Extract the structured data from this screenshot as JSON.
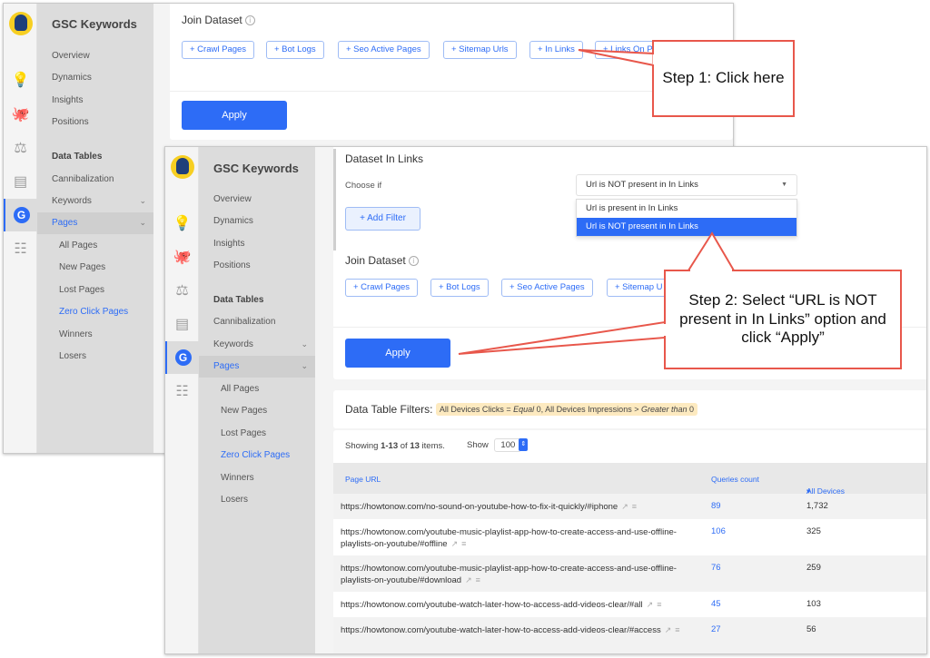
{
  "app": {
    "title": "GSC Keywords"
  },
  "sidebar": {
    "icons": [
      "app-logo-icon",
      "seo-bulb-gear-icon",
      "octopus-icon",
      "scales-icon",
      "log-files-icon",
      "google-g-icon",
      "data-table-icon"
    ],
    "items": [
      {
        "label": "Overview"
      },
      {
        "label": "Dynamics"
      },
      {
        "label": "Insights"
      },
      {
        "label": "Positions"
      }
    ],
    "data_tables_heading": "Data Tables",
    "data_table_items": [
      {
        "label": "Cannibalization"
      },
      {
        "label": "Keywords"
      },
      {
        "label": "Pages"
      }
    ],
    "page_subitems": [
      {
        "label": "All Pages"
      },
      {
        "label": "New Pages"
      },
      {
        "label": "Lost Pages"
      },
      {
        "label": "Zero Click Pages"
      },
      {
        "label": "Winners"
      },
      {
        "label": "Losers"
      }
    ],
    "active_item": "Pages",
    "active_subitem": "Zero Click Pages"
  },
  "window1": {
    "join_dataset_title": "Join Dataset",
    "dataset_buttons": [
      "+ Crawl Pages",
      "+ Bot Logs",
      "+ Seo Active Pages",
      "+ Sitemap Urls",
      "+ In Links",
      "+ Links On P"
    ],
    "apply_label": "Apply"
  },
  "window2": {
    "dataset_in_links_title": "Dataset In Links",
    "choose_if_label": "Choose if",
    "choose_if_value": "Url is NOT present in In Links",
    "dropdown_options": [
      "Url is present in In Links",
      "Url is NOT present in In Links"
    ],
    "selected_option_index": 1,
    "add_filter_label": "+ Add Filter",
    "join_dataset_title": "Join Dataset",
    "dataset_buttons": [
      "+ Crawl Pages",
      "+ Bot Logs",
      "+ Seo Active Pages",
      "+ Sitemap U"
    ],
    "apply_label": "Apply",
    "filters_label": "Data Table Filters:",
    "filters": {
      "part1": "All Devices Clicks = ",
      "part1_em": "Equal",
      "part2": " 0, All Devices Impressions > ",
      "part2_em": "Greater than",
      "part3": " 0"
    },
    "showing": {
      "prefix": "Showing ",
      "range": "1-13",
      "mid": " of ",
      "total": "13",
      "suffix": " items.",
      "show_label": "Show",
      "page_size": "100"
    },
    "table": {
      "columns": [
        "Page URL",
        "Queries count",
        "All Devices Impressions"
      ],
      "sorted_column": "All Devices Impressions",
      "rows": [
        {
          "url": "https://howtonow.com/no-sound-on-youtube-how-to-fix-it-quickly/#iphone",
          "queries": "89",
          "impressions": "1,732"
        },
        {
          "url": "https://howtonow.com/youtube-music-playlist-app-how-to-create-access-and-use-offline-playlists-on-youtube/#offline",
          "queries": "106",
          "impressions": "325"
        },
        {
          "url": "https://howtonow.com/youtube-music-playlist-app-how-to-create-access-and-use-offline-playlists-on-youtube/#download",
          "queries": "76",
          "impressions": "259"
        },
        {
          "url": "https://howtonow.com/youtube-watch-later-how-to-access-add-videos-clear/#all",
          "queries": "45",
          "impressions": "103"
        },
        {
          "url": "https://howtonow.com/youtube-watch-later-how-to-access-add-videos-clear/#access",
          "queries": "27",
          "impressions": "56"
        }
      ]
    }
  },
  "annotations": {
    "step1": "Step 1: Click here",
    "step2": "Step 2: Select “URL is NOT present in In Links” option and click “Apply”",
    "callout_color": "#e8574b"
  },
  "colors": {
    "accent": "#2d6cf6",
    "filter_badge": "#fdeac0",
    "sidebar_bg": "#dcdcdc"
  }
}
